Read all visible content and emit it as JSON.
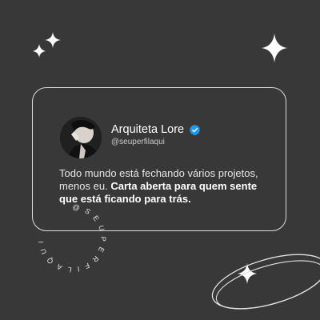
{
  "profile": {
    "name": "Arquiteta Lore",
    "handle": "@seuperfilaqui",
    "verified_icon": "verified-badge-icon",
    "verified_color": "#1d9bf0"
  },
  "tweet": {
    "regular": "Todo mundo está fechando vários projetos, menos eu.",
    "bold": "Carta aberta para quem sente que está ficando para trás."
  },
  "watermark": {
    "circular_text": "@SEUPERFILAQUI"
  },
  "colors": {
    "background": "#383838",
    "card_border": "#dcdcdc",
    "text": "#ffffff"
  }
}
